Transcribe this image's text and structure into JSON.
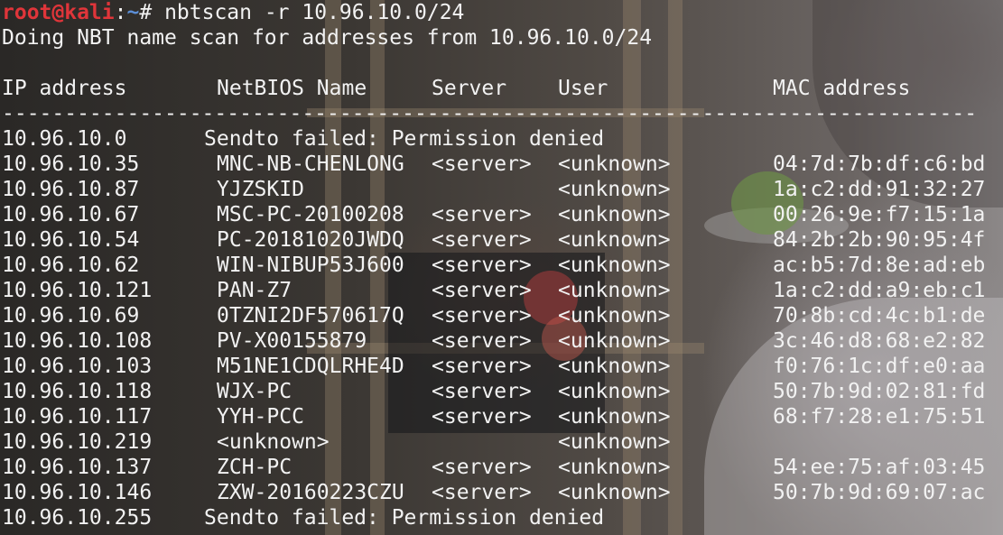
{
  "prompt": {
    "user_host": "root@kali",
    "separator": ":",
    "path": "~",
    "symbol": "#",
    "command": "nbtscan -r 10.96.10.0/24"
  },
  "scan_message": "Doing NBT name scan for addresses from 10.96.10.0/24",
  "headers": {
    "ip": "IP address",
    "name": "NetBIOS Name",
    "server": "Server",
    "user": "User",
    "mac": "MAC address"
  },
  "separator_line": "------------------------------------------------------------------------------",
  "rows": [
    {
      "ip": "10.96.10.0",
      "error": "Sendto failed: Permission denied"
    },
    {
      "ip": "10.96.10.35",
      "name": "MNC-NB-CHENLONG",
      "server": "<server>",
      "user": "<unknown>",
      "mac": "04:7d:7b:df:c6:bd"
    },
    {
      "ip": "10.96.10.87",
      "name": "YJZSKID",
      "server": "",
      "user": "<unknown>",
      "mac": "1a:c2:dd:91:32:27"
    },
    {
      "ip": "10.96.10.67",
      "name": "MSC-PC-20100208",
      "server": "<server>",
      "user": "<unknown>",
      "mac": "00:26:9e:f7:15:1a"
    },
    {
      "ip": "10.96.10.54",
      "name": "PC-20181020JWDQ",
      "server": "<server>",
      "user": "<unknown>",
      "mac": "84:2b:2b:90:95:4f"
    },
    {
      "ip": "10.96.10.62",
      "name": "WIN-NIBUP53J600",
      "server": "<server>",
      "user": "<unknown>",
      "mac": "ac:b5:7d:8e:ad:eb"
    },
    {
      "ip": "10.96.10.121",
      "name": "PAN-Z7",
      "server": "<server>",
      "user": "<unknown>",
      "mac": "1a:c2:dd:a9:eb:c1"
    },
    {
      "ip": "10.96.10.69",
      "name": "0TZNI2DF570617Q",
      "server": "<server>",
      "user": "<unknown>",
      "mac": "70:8b:cd:4c:b1:de"
    },
    {
      "ip": "10.96.10.108",
      "name": "PV-X00155879",
      "server": "<server>",
      "user": "<unknown>",
      "mac": "3c:46:d8:68:e2:82"
    },
    {
      "ip": "10.96.10.103",
      "name": "M51NE1CDQLRHE4D",
      "server": "<server>",
      "user": "<unknown>",
      "mac": "f0:76:1c:df:e0:aa"
    },
    {
      "ip": "10.96.10.118",
      "name": "WJX-PC",
      "server": "<server>",
      "user": "<unknown>",
      "mac": "50:7b:9d:02:81:fd"
    },
    {
      "ip": "10.96.10.117",
      "name": "YYH-PCC",
      "server": "<server>",
      "user": "<unknown>",
      "mac": "68:f7:28:e1:75:51"
    },
    {
      "ip": "10.96.10.219",
      "name": "<unknown>",
      "server": "",
      "user": "<unknown>",
      "mac": ""
    },
    {
      "ip": "10.96.10.137",
      "name": "ZCH-PC",
      "server": "<server>",
      "user": "<unknown>",
      "mac": "54:ee:75:af:03:45"
    },
    {
      "ip": "10.96.10.146",
      "name": "ZXW-20160223CZU",
      "server": "<server>",
      "user": "<unknown>",
      "mac": "50:7b:9d:69:07:ac"
    },
    {
      "ip": "10.96.10.255",
      "error": "Sendto failed: Permission denied"
    }
  ],
  "colors": {
    "prompt_user": "#e0353a",
    "prompt_path": "#5c8fd6",
    "text": "#f2f2f2"
  }
}
